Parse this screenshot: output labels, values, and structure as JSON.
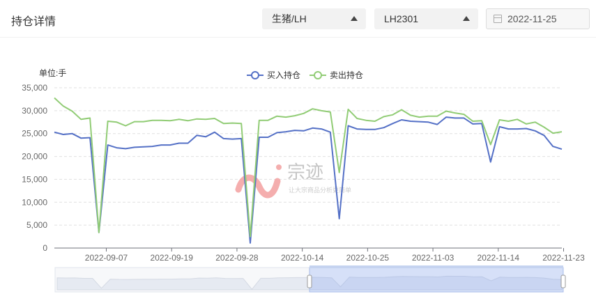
{
  "header": {
    "title": "持仓详情",
    "variety_select": "生猪/LH",
    "contract_select": "LH2301",
    "date_value": "2022-11-25"
  },
  "watermark": {
    "brand": "宗迹",
    "slogan": "让大宗商品分析更简单"
  },
  "chart_data": {
    "type": "line",
    "ylabel": "单位:手",
    "ylim": [
      0,
      35000
    ],
    "y_ticks": [
      "0",
      "5,000",
      "10,000",
      "15,000",
      "20,000",
      "25,000",
      "30,000",
      "35,000"
    ],
    "x_tick_labels": [
      "2022-09-07",
      "2022-09-19",
      "2022-09-28",
      "2022-10-14",
      "2022-10-25",
      "2022-11-03",
      "2022-11-14",
      "2022-11-23"
    ],
    "legend_position": "top-center",
    "grid": "horizontal-dashed",
    "series": [
      {
        "name": "买入持仓",
        "color": "#5470c6",
        "values": [
          25300,
          24800,
          25000,
          24000,
          24100,
          3400,
          22500,
          21900,
          21700,
          22000,
          22100,
          22200,
          22500,
          22500,
          22900,
          22900,
          24600,
          24300,
          25300,
          23900,
          23800,
          23900,
          1100,
          24200,
          24200,
          25200,
          25400,
          25700,
          25600,
          26200,
          26000,
          25300,
          6400,
          26700,
          26000,
          25900,
          25900,
          26300,
          27200,
          28000,
          27700,
          27600,
          27500,
          27000,
          28600,
          28400,
          28400,
          27100,
          27200,
          18800,
          26500,
          26000,
          26000,
          26100,
          25600,
          24600,
          22200,
          21600
        ]
      },
      {
        "name": "卖出持仓",
        "color": "#91cc75",
        "values": [
          32800,
          31000,
          29900,
          28100,
          28400,
          3400,
          27700,
          27500,
          26700,
          27600,
          27600,
          27900,
          27900,
          27800,
          28100,
          27800,
          28200,
          28100,
          28300,
          27200,
          27300,
          27200,
          2500,
          27900,
          27900,
          28800,
          28600,
          28900,
          29400,
          30400,
          30000,
          29700,
          16500,
          30300,
          28300,
          27900,
          27700,
          28700,
          29100,
          30200,
          29000,
          28600,
          28800,
          28800,
          29900,
          29500,
          29200,
          27700,
          27800,
          22600,
          28000,
          27700,
          28100,
          27100,
          27500,
          26400,
          25100,
          25400
        ]
      }
    ]
  }
}
